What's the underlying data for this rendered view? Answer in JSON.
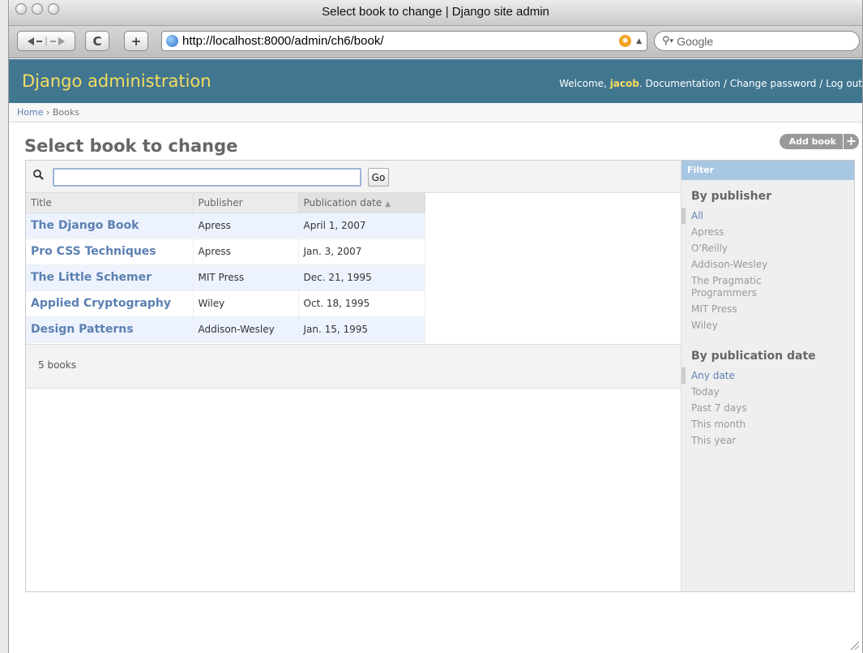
{
  "window": {
    "title": "Select book to change | Django site admin"
  },
  "toolbar": {
    "reload_glyph": "C",
    "add_glyph": "+",
    "url": "http://localhost:8000/admin/ch6/book/",
    "search_placeholder": "Google"
  },
  "header": {
    "brand": "Django administration",
    "welcome": "Welcome,",
    "username": "jacob",
    "links": [
      "Documentation",
      "Change password",
      "Log out"
    ],
    "separator": " / "
  },
  "breadcrumbs": {
    "home": "Home",
    "separator": " › ",
    "current": "Books"
  },
  "content": {
    "title": "Select book to change",
    "add_label": "Add book",
    "add_glyph": "+"
  },
  "search": {
    "value": "",
    "go_label": "Go"
  },
  "results": {
    "columns": [
      "Title",
      "Publisher",
      "Publication date"
    ],
    "sort_indicator": "▲",
    "rows": [
      {
        "title": "The Django Book",
        "publisher": "Apress",
        "date": "April 1, 2007"
      },
      {
        "title": "Pro CSS Techniques",
        "publisher": "Apress",
        "date": "Jan. 3, 2007"
      },
      {
        "title": "The Little Schemer",
        "publisher": "MIT Press",
        "date": "Dec. 21, 1995"
      },
      {
        "title": "Applied Cryptography",
        "publisher": "Wiley",
        "date": "Oct. 18, 1995"
      },
      {
        "title": "Design Patterns",
        "publisher": "Addison-Wesley",
        "date": "Jan. 15, 1995"
      }
    ],
    "count_text": "5 books"
  },
  "filter": {
    "heading": "Filter",
    "publisher": {
      "title": "By publisher",
      "options": [
        "All",
        "Apress",
        "O'Reilly",
        "Addison-Wesley",
        "The Pragmatic Programmers",
        "MIT Press",
        "Wiley"
      ]
    },
    "date": {
      "title": "By publication date",
      "options": [
        "Any date",
        "Today",
        "Past 7 days",
        "This month",
        "This year"
      ]
    }
  }
}
